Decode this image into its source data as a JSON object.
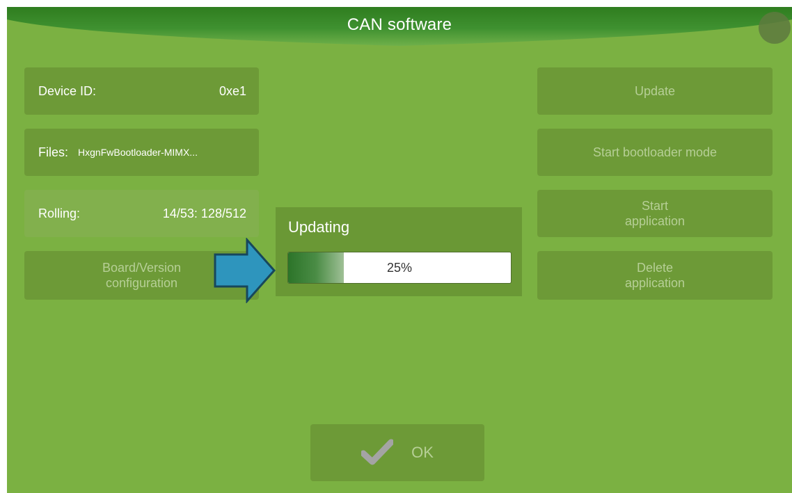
{
  "header": {
    "title": "CAN software"
  },
  "left_panel": {
    "device_id": {
      "label": "Device ID:",
      "value": "0xe1"
    },
    "files": {
      "label": "Files:",
      "value": "HxgnFwBootloader-MIMX..."
    },
    "rolling": {
      "label": "Rolling:",
      "value": "14/53: 128/512"
    },
    "board_version": {
      "label": "Board/Version\nconfiguration"
    }
  },
  "right_panel": {
    "update": {
      "label": "Update"
    },
    "start_bootloader": {
      "label": "Start bootloader mode"
    },
    "start_application": {
      "label": "Start\napplication"
    },
    "delete_application": {
      "label": "Delete\napplication"
    }
  },
  "dialog": {
    "title": "Updating",
    "progress": {
      "percent": 25,
      "label": "25%"
    }
  },
  "footer": {
    "ok": {
      "label": "OK",
      "icon": "checkmark-icon"
    }
  },
  "annotations": {
    "arrow": {
      "icon": "arrow-right-icon",
      "color": "#2e95bd"
    }
  },
  "colors": {
    "background": "#7bb142",
    "panel": "#6d9a37",
    "title_bar": "#3f8a2a",
    "disabled_text": "#b6cf96",
    "progress_fill": "#2c7429"
  }
}
